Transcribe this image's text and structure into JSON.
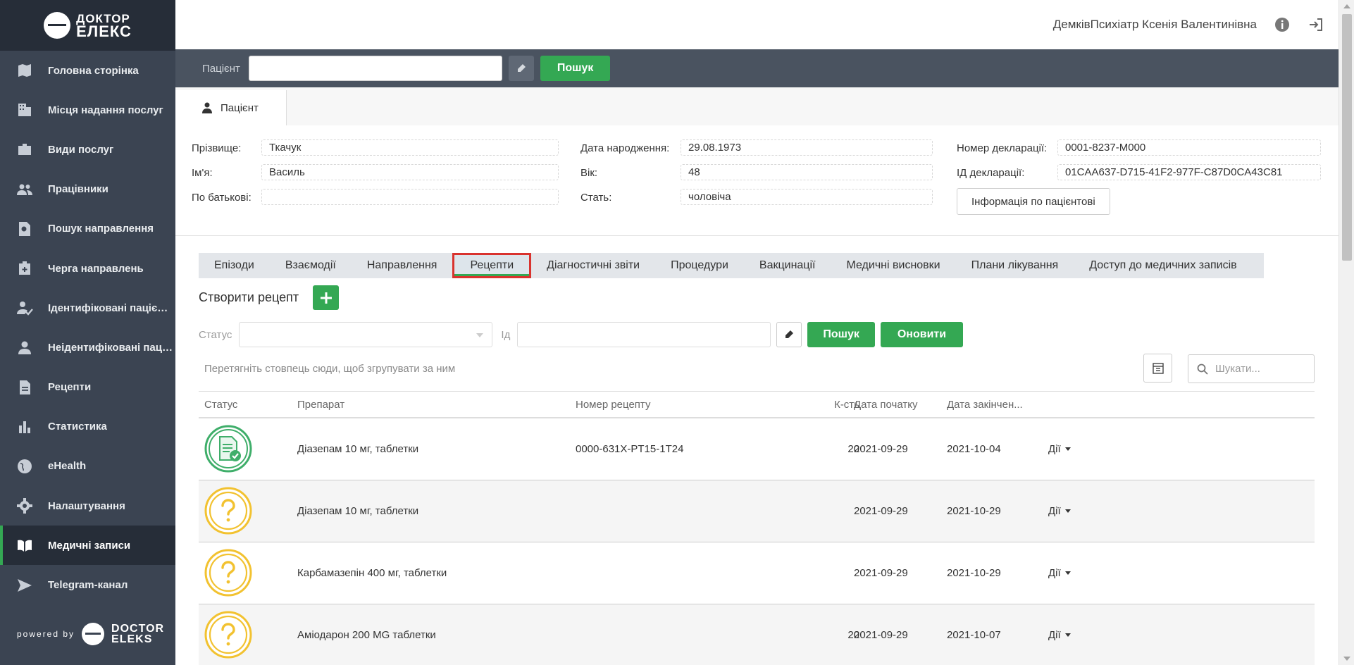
{
  "app": {
    "brand_line1": "ДОКТОР",
    "brand_line2": "ЕЛЕКС",
    "powered_by": "powered by",
    "powered_brand1": "DOCTOR",
    "powered_brand2": "ELEKS",
    "accent": "#34a853",
    "sidebar_bg": "#3b4452"
  },
  "sidebar": {
    "items": [
      {
        "label": "Головна сторінка",
        "icon": "map-icon"
      },
      {
        "label": "Місця надання послуг",
        "icon": "building-icon"
      },
      {
        "label": "Види послуг",
        "icon": "briefcase-icon"
      },
      {
        "label": "Працівники",
        "icon": "people-icon"
      },
      {
        "label": "Пошук направлення",
        "icon": "search-doc-icon"
      },
      {
        "label": "Черга направлень",
        "icon": "queue-icon"
      },
      {
        "label": "Ідентифіковані пацієнти",
        "icon": "user-check-icon"
      },
      {
        "label": "Неідентифіковані пацієнти",
        "icon": "user-icon"
      },
      {
        "label": "Рецепти",
        "icon": "document-icon"
      },
      {
        "label": "Статистика",
        "icon": "bar-chart-icon"
      },
      {
        "label": "eHealth",
        "icon": "globe-icon"
      },
      {
        "label": "Налаштування",
        "icon": "gear-icon"
      },
      {
        "label": "Медичні записи",
        "icon": "book-icon"
      },
      {
        "label": "Telegram-канал",
        "icon": "send-icon"
      }
    ],
    "active": "Медичні записи"
  },
  "header": {
    "user_name": "ДемківПсихіатр Ксенія Валентинівна"
  },
  "search": {
    "label": "Пацієнт",
    "value": "",
    "button": "Пошук"
  },
  "patient": {
    "tab_label": "Пацієнт",
    "surname_label": "Прізвище:",
    "surname": "Ткачук",
    "name_label": "Ім'я:",
    "name": "Василь",
    "patronymic_label": "По батькові:",
    "patronymic": "",
    "dob_label": "Дата народження:",
    "dob": "29.08.1973",
    "age_label": "Вік:",
    "age": "48",
    "sex_label": "Стать:",
    "sex": "чоловіча",
    "decl_num_label": "Номер декларації:",
    "decl_num": "0001-8237-M000",
    "decl_id_label": "ІД декларації:",
    "decl_id": "01CAA637-D715-41F2-977F-C87D0CA43C81",
    "info_button": "Інформація по пацієнтові"
  },
  "tabs": [
    "Епізоди",
    "Взаємодії",
    "Направлення",
    "Рецепти",
    "Діагностичні звіти",
    "Процедури",
    "Вакцинації",
    "Медичні висновки",
    "Плани лікування",
    "Доступ до медичних записів"
  ],
  "active_tab": "Рецепти",
  "create": {
    "label": "Створити рецепт"
  },
  "filters": {
    "status_label": "Статус",
    "status_value": "",
    "id_label": "Ід",
    "id_value": "",
    "search_button": "Пошук",
    "refresh_button": "Оновити"
  },
  "grid": {
    "group_hint": "Перетягніть стовпець сюди, щоб згрупувати за ним",
    "search_placeholder": "Шукати...",
    "columns": [
      "Статус",
      "Препарат",
      "Номер рецепту",
      "К-сть",
      "Дата початку",
      "Дата закінчен..."
    ],
    "rows": [
      {
        "status": "active",
        "drug": "Діазепам 10 мг, таблетки",
        "number": "0000-631X-PT15-1T24",
        "qty": "20",
        "start": "2021-09-29",
        "end": "2021-10-04",
        "actions": "Дії"
      },
      {
        "status": "unknown",
        "drug": "Діазепам 10 мг, таблетки",
        "number": "",
        "qty": "",
        "start": "2021-09-29",
        "end": "2021-10-29",
        "actions": "Дії"
      },
      {
        "status": "unknown",
        "drug": "Карбамазепін 400 мг, таблетки",
        "number": "",
        "qty": "",
        "start": "2021-09-29",
        "end": "2021-10-29",
        "actions": "Дії"
      },
      {
        "status": "unknown",
        "drug": "Аміодарон 200 MG таблетки",
        "number": "",
        "qty": "20",
        "start": "2021-09-29",
        "end": "2021-10-07",
        "actions": "Дії"
      }
    ]
  }
}
